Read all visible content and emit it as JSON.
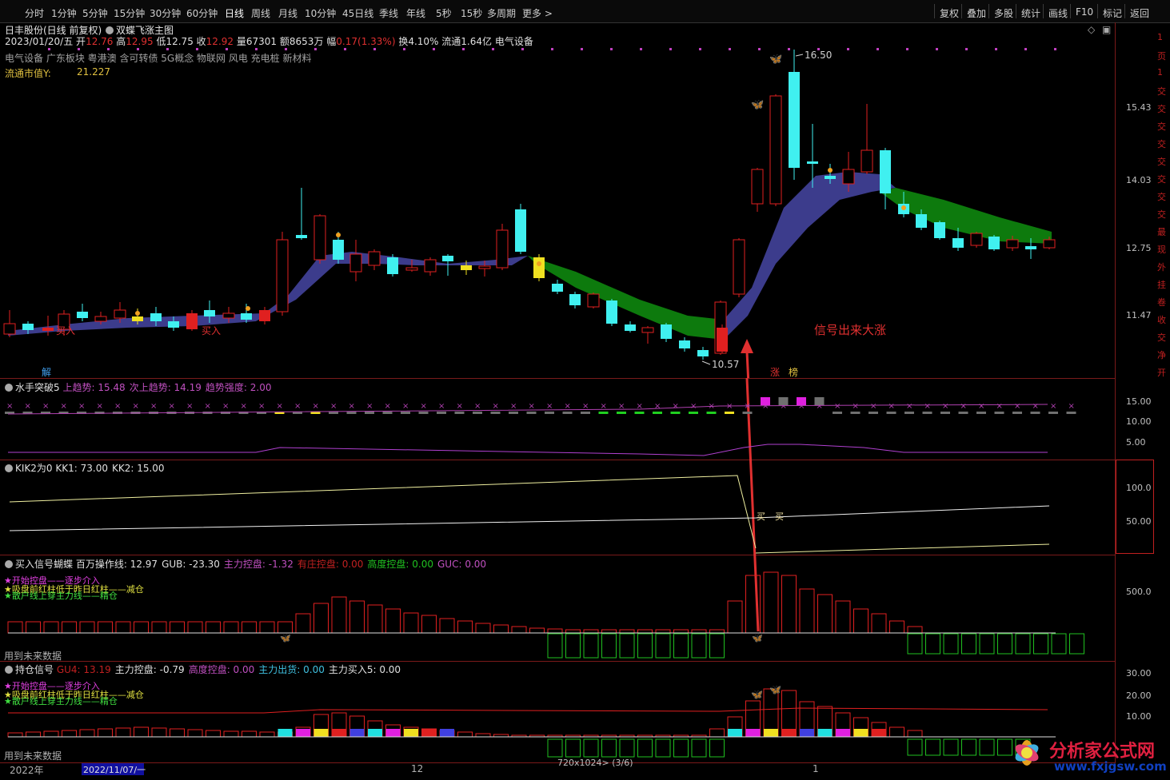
{
  "toolbar": {
    "periods": [
      "分时",
      "1分钟",
      "5分钟",
      "15分钟",
      "30分钟",
      "60分钟",
      "日线",
      "周线",
      "月线",
      "10分钟",
      "45日线",
      "季线",
      "年线",
      "5秒",
      "15秒",
      "多周期",
      "更多"
    ],
    "active_period": "日线",
    "right_buttons": [
      "复权",
      "叠加",
      "多股",
      "统计",
      "画线",
      "F10",
      "标记",
      "返回"
    ]
  },
  "stock": {
    "name": "日丰股份(日线 前复权)",
    "indicator_name": "双蝶飞涨主图",
    "info": {
      "date": "2023/01/20/五",
      "open_label": "开",
      "open": "12.76",
      "high_label": "高",
      "high": "12.95",
      "low_label": "低",
      "low": "12.75",
      "close_label": "收",
      "close": "12.92",
      "volume_label": "量",
      "volume": "67301",
      "amount_label": "额",
      "amount": "8653万",
      "change_label": "幅",
      "change": "0.17(1.33%)",
      "turnover": "换4.10%",
      "float": "流通1.64亿",
      "industry": "电气设备"
    },
    "concepts": "电气设备 广东板块 粤港澳 含可转债 5G概念 物联网 风电 充电桩 新材料",
    "float_cap_label": "流通市值Y:",
    "float_cap_value": "21.227"
  },
  "main_chart": {
    "price_labels": [
      "15.43",
      "14.03",
      "12.75",
      "11.47"
    ],
    "annotations": {
      "high": "16.50",
      "low": "10.57",
      "signal_text": "信号出来大涨",
      "buy1": "买入",
      "buy2": "买入",
      "jie": "解",
      "zhang": "涨",
      "bang": "榜"
    }
  },
  "panel2": {
    "title": "水手突破5",
    "fields": [
      {
        "label": "上趋势:",
        "value": "15.48",
        "color": "#c050c0"
      },
      {
        "label": "次上趋势:",
        "value": "14.19",
        "color": "#c050c0"
      },
      {
        "label": "趋势强度:",
        "value": "2.00",
        "color": "#c050c0"
      }
    ],
    "y_labels": [
      "15.00",
      "10.00",
      "5.00"
    ]
  },
  "panel3": {
    "title": "KIK2为0",
    "fields": [
      {
        "label": "KK1:",
        "value": "73.00",
        "color": "#e0e0e0"
      },
      {
        "label": "KK2:",
        "value": "15.00",
        "color": "#e0e0e0"
      }
    ],
    "y_labels": [
      "100.0",
      "50.00"
    ],
    "marks": [
      "买",
      "买"
    ]
  },
  "panel4": {
    "title": "买入信号蝴蝶",
    "fields": [
      {
        "label": "百万操作线:",
        "value": "12.97",
        "color": "#e0e0e0"
      },
      {
        "label": "GUB:",
        "value": "-23.30",
        "color": "#e0e0e0"
      },
      {
        "label": "主力控盘:",
        "value": "-1.32",
        "color": "#c050c0"
      },
      {
        "label": "有庄控盘:",
        "value": "0.00",
        "color": "#c02020"
      },
      {
        "label": "高度控盘:",
        "value": "0.00",
        "color": "#20c020"
      },
      {
        "label": "GUC:",
        "value": "0.00",
        "color": "#c050c0"
      }
    ],
    "legend": [
      "★开始控盘——逐步介入",
      "★吸盘前红柱低于昨日红柱——减仓",
      "★散户线上穿主力线——精仓"
    ],
    "footer": "用到未来数据",
    "y_labels": [
      "500.0"
    ]
  },
  "panel5": {
    "title": "持仓信号",
    "fields": [
      {
        "label": "GU4:",
        "value": "13.19",
        "color": "#c02020"
      },
      {
        "label": "主力控盘:",
        "value": "-0.79",
        "color": "#e0e0e0"
      },
      {
        "label": "高度控盘:",
        "value": "0.00",
        "color": "#c050c0"
      },
      {
        "label": "主力出货:",
        "value": "0.00",
        "color": "#40c0e0"
      },
      {
        "label": "主力买入5:",
        "value": "0.00",
        "color": "#e0e0e0"
      }
    ],
    "legend": [
      "★开始控盘——逐步介入",
      "★吸盘前红柱低于昨日红柱——减仓",
      "★散户线上穿主力线——精仓"
    ],
    "footer": "用到未来数据",
    "y_labels": [
      "30.00",
      "20.00",
      "10.00"
    ]
  },
  "bottom": {
    "year": "2022年",
    "date_box": "2022/11/07/一",
    "month": "12",
    "mark": "1",
    "page_info": "720x1024> (3/6)"
  },
  "watermark": {
    "name": "分析家公式网",
    "url": "www.fxjgsw.com"
  },
  "side_labels": [
    "1",
    "页",
    "1",
    "交",
    "交",
    "交",
    "交",
    "交",
    "交",
    "交",
    "交",
    "最",
    "现",
    "外",
    "挂",
    "卷",
    "收",
    "交",
    "净",
    "开"
  ]
}
